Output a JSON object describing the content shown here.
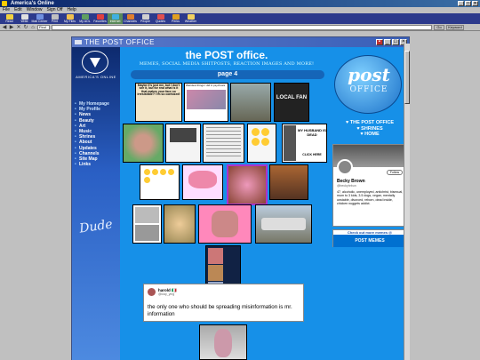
{
  "app": {
    "title": "America's Online",
    "menus": [
      "File",
      "Edit",
      "Window",
      "Sign Off",
      "Help"
    ]
  },
  "toolbar": {
    "buttons": [
      {
        "label": "Read",
        "color": "#f0d040"
      },
      {
        "label": "Write",
        "color": "#e0e0e0"
      },
      {
        "label": "Mail Center",
        "color": "#7090e0"
      },
      {
        "label": "Print",
        "color": "#c0c0c0"
      },
      {
        "label": "My Files",
        "color": "#f0c050"
      },
      {
        "label": "My AOL",
        "color": "#60a060"
      },
      {
        "label": "Favorites",
        "color": "#e04040"
      },
      {
        "label": "Internet",
        "color": "#40b0e0"
      },
      {
        "label": "Channels",
        "color": "#e08030"
      },
      {
        "label": "People",
        "color": "#d0d0d0"
      },
      {
        "label": "Quotes",
        "color": "#e05050"
      },
      {
        "label": "Perks",
        "color": "#e0a020"
      },
      {
        "label": "Weather",
        "color": "#f0d060"
      }
    ]
  },
  "addressbar": {
    "keyword": "Find",
    "go_label": "Go",
    "keyword_label": "Keyword"
  },
  "window": {
    "title": "THE POST OFFICE"
  },
  "sidebar": {
    "logo_text": "AMERICA'S ONLINE",
    "signature": "Dude",
    "items": [
      "My Homepage",
      "My Profile",
      "News",
      "Beauty",
      "Art",
      "Music",
      "Shrines",
      "About",
      "Updates",
      "Channels",
      "Site Map",
      "Links"
    ]
  },
  "header": {
    "title": "the POST office.",
    "subtitle": "MEMES, SOCIAL MEDIA SHITPOSTS, REACTION IMAGES AND MORE!",
    "page": "page 4"
  },
  "logo": {
    "line1": "post",
    "line2": "OFFICE"
  },
  "right_links": [
    "♥ THE POST OFFICE",
    "♥ SHRINES",
    "♥ HOME"
  ],
  "profile": {
    "name": "Becky Brown",
    "handle": "@beckyhrbun",
    "follow_label": "Follow",
    "bio": "47, alcoholic, unemployed, antichrist, bisexual, mum to 3 kids, 3.5 dogs, vegan, mentally unstable, divorced, reborn, dead inside, chicken nuggets addict."
  },
  "checkout": {
    "title": "Check out more memes @",
    "banner": "POST MEMES"
  },
  "memes": {
    "m1": "Maybe it's just me, but I don't see it, but for real what is it that makes your face so irresistible?! I'm so confused!",
    "m2": "Weirdest things I did in psychosis",
    "m3": "LOCAL FAN",
    "m9": "MY HUSBAND IS DEAD",
    "m9b": "CLICK HERE"
  },
  "tweet": {
    "name": "harold 🇮🇹",
    "handle": "@clay_ying",
    "text": "the only one who should be spreading misinformation is mr. information"
  }
}
